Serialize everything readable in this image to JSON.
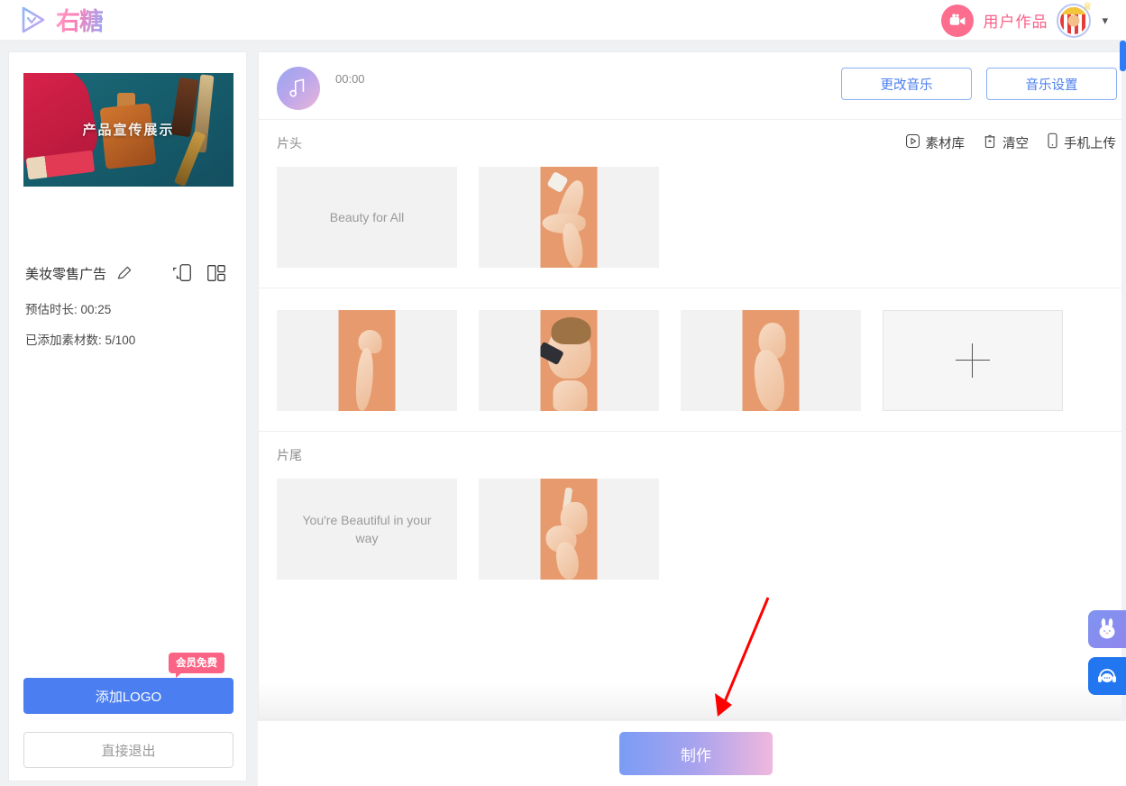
{
  "app": {
    "logo_text": "右糖",
    "logo_icon": "play-triangle-icon"
  },
  "topbar": {
    "works_icon": "video-camera-icon",
    "works_label": "用户作品",
    "avatar_name": "popcorn-avatar",
    "crown_icon": "crown-icon",
    "chevron_icon": "chevron-down-icon"
  },
  "sidebar": {
    "thumbnail_overlay_text": "产品宣传展示",
    "project_name": "美妆零售广告",
    "edit_icon": "pencil-icon",
    "ratio_icon": "aspect-ratio-icon",
    "layout_icon": "layout-template-icon",
    "duration_label": "预估时长: 00:25",
    "material_count_label": "已添加素材数: 5/100",
    "add_logo_label": "添加LOGO",
    "vip_badge_label": "会员免费",
    "exit_label": "直接退出"
  },
  "music": {
    "disc_icon": "music-note-icon",
    "time": "00:00",
    "change_music_label": "更改音乐",
    "music_settings_label": "音乐设置"
  },
  "sections": [
    {
      "title": "片头",
      "actions": [
        {
          "label": "素材库",
          "icon": "media-library-icon"
        },
        {
          "label": "清空",
          "icon": "trash-icon"
        },
        {
          "label": "手机上传",
          "icon": "phone-upload-icon"
        }
      ],
      "items": [
        {
          "type": "text",
          "text": "Beauty for All"
        },
        {
          "type": "photo",
          "alt": "hand-holding-cosmetic-tube"
        }
      ]
    },
    {
      "title": "",
      "actions": [],
      "items": [
        {
          "type": "photo",
          "alt": "raised-hand-on-peach-background"
        },
        {
          "type": "photo",
          "alt": "woman-applying-makeup-brush"
        },
        {
          "type": "photo",
          "alt": "clasped-hands-on-peach-background"
        },
        {
          "type": "add",
          "text": ""
        }
      ]
    },
    {
      "title": "片尾",
      "actions": [],
      "items": [
        {
          "type": "text",
          "text": "You're Beautiful in your way"
        },
        {
          "type": "photo",
          "alt": "hands-holding-serum-dropper"
        }
      ]
    }
  ],
  "footer": {
    "make_label": "制作"
  },
  "floating": [
    {
      "name": "bunny-assistant-icon"
    },
    {
      "name": "customer-service-icon"
    }
  ],
  "annotation": {
    "arrow_color": "#ff0000",
    "arrow_name": "red-pointer-arrow"
  },
  "colors": {
    "primary_blue": "#4b7ef0",
    "accent_pink": "#fb6385",
    "make_gradient_start": "#7a9cf5",
    "make_gradient_end": "#f0b8dd"
  }
}
